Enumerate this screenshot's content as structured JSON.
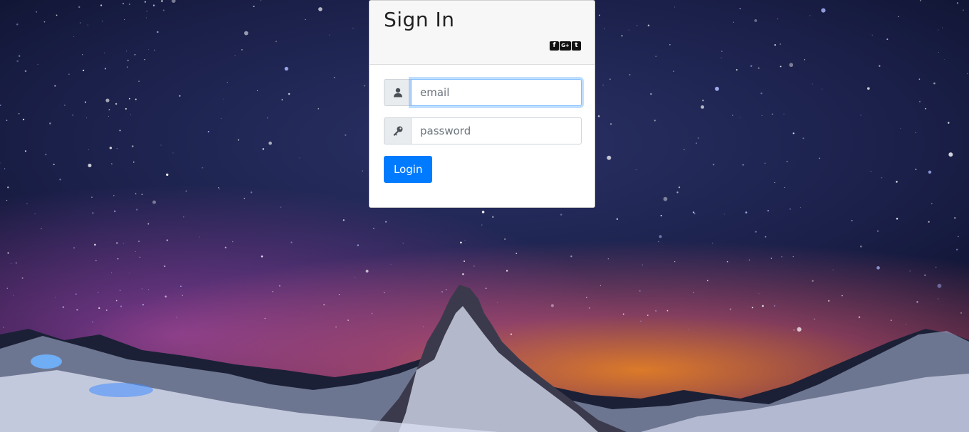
{
  "login_card": {
    "title": "Sign In",
    "social_icons": [
      "facebook-icon",
      "google-plus-icon",
      "twitter-icon"
    ],
    "social_glyphs": {
      "facebook": "f",
      "google_plus": "G+",
      "twitter": "t"
    },
    "email": {
      "placeholder": "email",
      "value": "",
      "icon": "user-icon"
    },
    "password": {
      "placeholder": "password",
      "value": "",
      "icon": "key-icon"
    },
    "login_button_label": "Login"
  },
  "colors": {
    "accent": "#007bff",
    "header_bg": "#f7f7f7",
    "focus_border": "#80bdff"
  }
}
